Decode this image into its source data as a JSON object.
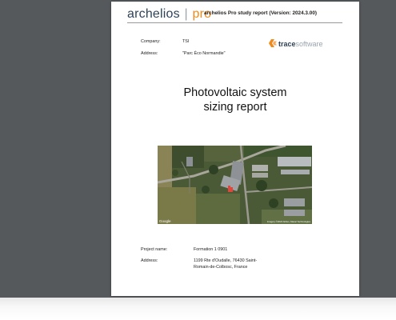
{
  "header": {
    "logo_main": "archelios",
    "logo_sep": "|",
    "logo_pro": "pro",
    "report_title": "archelios Pro study report   (Version: 2024.3.00)"
  },
  "company": {
    "label": "Company:",
    "value": "TSI"
  },
  "address": {
    "label": "Address:",
    "value": "\"Parc Éco Normandie\""
  },
  "brand": {
    "name_bold": "trace",
    "name_light": "software",
    "color": "#f08a1c"
  },
  "title": {
    "line1": "Photovoltaic system",
    "line2": "sizing report"
  },
  "map": {
    "google_label": "Google",
    "attribution": "Imagery ©2024 Airbus, Maxar Technologies"
  },
  "project": {
    "name_label": "Project name:",
    "name_value": "Formation 1 0901",
    "address_label": "Address:",
    "address_line1": "1199 Rte d'Oudalle, 76430 Saint-",
    "address_line2": "Romain-de-Colbosc, France"
  },
  "colors": {
    "viewer_bg": "#55595c",
    "logo_dark": "#2f4358",
    "accent": "#f08a1c"
  }
}
